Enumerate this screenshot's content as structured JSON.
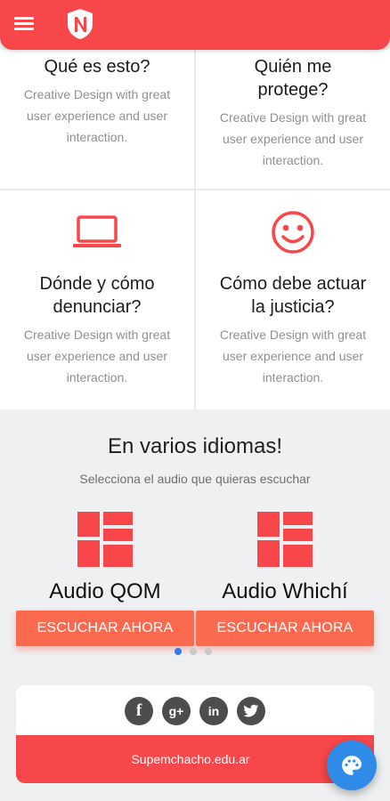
{
  "colors": {
    "brand": "#f7474a",
    "button": "#fb6a4f",
    "accent_blue": "#2f79ea"
  },
  "header": {
    "menu_icon": "hamburger-menu-icon",
    "logo_icon": "shield-n-logo"
  },
  "features": [
    {
      "title": "Qué es esto?",
      "text": "Creative Design with great user experience and user interaction."
    },
    {
      "title": "Quién me protege?",
      "text": "Creative Design with great user experience and user interaction."
    },
    {
      "title": "Dónde y cómo denunciar?",
      "text": "Creative Design with great user experience and user interaction.",
      "icon": "laptop-icon"
    },
    {
      "title": "Cómo debe actuar la justicia?",
      "text": "Creative Design with great user experience and user interaction.",
      "icon": "smiley-icon"
    }
  ],
  "languages": {
    "title": "En varios idiomas!",
    "subtitle": "Selecciona el audio que quieras escuchar",
    "audios": [
      {
        "name": "Audio QOM",
        "button": "ESCUCHAR AHORA",
        "icon": "grid-tiles-icon"
      },
      {
        "name": "Audio Whichí",
        "button": "ESCUCHAR AHORA",
        "icon": "grid-tiles-icon"
      }
    ],
    "pagination": {
      "pages": 3,
      "active": 1
    }
  },
  "footer": {
    "socials": [
      "facebook-icon",
      "google-plus-icon",
      "linkedin-icon",
      "twitter-icon"
    ],
    "site": "Supemchacho.edu.ar"
  },
  "fab_icon": "palette-icon"
}
